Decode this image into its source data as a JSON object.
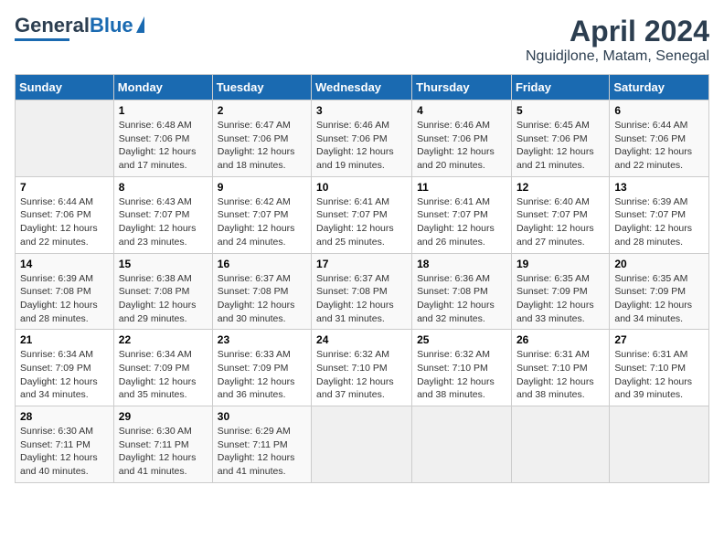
{
  "header": {
    "logo_line1": "General",
    "logo_line2": "Blue",
    "title": "April 2024",
    "subtitle": "Nguidjlone, Matam, Senegal"
  },
  "weekdays": [
    "Sunday",
    "Monday",
    "Tuesday",
    "Wednesday",
    "Thursday",
    "Friday",
    "Saturday"
  ],
  "weeks": [
    [
      {
        "day": "",
        "info": ""
      },
      {
        "day": "1",
        "info": "Sunrise: 6:48 AM\nSunset: 7:06 PM\nDaylight: 12 hours\nand 17 minutes."
      },
      {
        "day": "2",
        "info": "Sunrise: 6:47 AM\nSunset: 7:06 PM\nDaylight: 12 hours\nand 18 minutes."
      },
      {
        "day": "3",
        "info": "Sunrise: 6:46 AM\nSunset: 7:06 PM\nDaylight: 12 hours\nand 19 minutes."
      },
      {
        "day": "4",
        "info": "Sunrise: 6:46 AM\nSunset: 7:06 PM\nDaylight: 12 hours\nand 20 minutes."
      },
      {
        "day": "5",
        "info": "Sunrise: 6:45 AM\nSunset: 7:06 PM\nDaylight: 12 hours\nand 21 minutes."
      },
      {
        "day": "6",
        "info": "Sunrise: 6:44 AM\nSunset: 7:06 PM\nDaylight: 12 hours\nand 22 minutes."
      }
    ],
    [
      {
        "day": "7",
        "info": "Sunrise: 6:44 AM\nSunset: 7:06 PM\nDaylight: 12 hours\nand 22 minutes."
      },
      {
        "day": "8",
        "info": "Sunrise: 6:43 AM\nSunset: 7:07 PM\nDaylight: 12 hours\nand 23 minutes."
      },
      {
        "day": "9",
        "info": "Sunrise: 6:42 AM\nSunset: 7:07 PM\nDaylight: 12 hours\nand 24 minutes."
      },
      {
        "day": "10",
        "info": "Sunrise: 6:41 AM\nSunset: 7:07 PM\nDaylight: 12 hours\nand 25 minutes."
      },
      {
        "day": "11",
        "info": "Sunrise: 6:41 AM\nSunset: 7:07 PM\nDaylight: 12 hours\nand 26 minutes."
      },
      {
        "day": "12",
        "info": "Sunrise: 6:40 AM\nSunset: 7:07 PM\nDaylight: 12 hours\nand 27 minutes."
      },
      {
        "day": "13",
        "info": "Sunrise: 6:39 AM\nSunset: 7:07 PM\nDaylight: 12 hours\nand 28 minutes."
      }
    ],
    [
      {
        "day": "14",
        "info": "Sunrise: 6:39 AM\nSunset: 7:08 PM\nDaylight: 12 hours\nand 28 minutes."
      },
      {
        "day": "15",
        "info": "Sunrise: 6:38 AM\nSunset: 7:08 PM\nDaylight: 12 hours\nand 29 minutes."
      },
      {
        "day": "16",
        "info": "Sunrise: 6:37 AM\nSunset: 7:08 PM\nDaylight: 12 hours\nand 30 minutes."
      },
      {
        "day": "17",
        "info": "Sunrise: 6:37 AM\nSunset: 7:08 PM\nDaylight: 12 hours\nand 31 minutes."
      },
      {
        "day": "18",
        "info": "Sunrise: 6:36 AM\nSunset: 7:08 PM\nDaylight: 12 hours\nand 32 minutes."
      },
      {
        "day": "19",
        "info": "Sunrise: 6:35 AM\nSunset: 7:09 PM\nDaylight: 12 hours\nand 33 minutes."
      },
      {
        "day": "20",
        "info": "Sunrise: 6:35 AM\nSunset: 7:09 PM\nDaylight: 12 hours\nand 34 minutes."
      }
    ],
    [
      {
        "day": "21",
        "info": "Sunrise: 6:34 AM\nSunset: 7:09 PM\nDaylight: 12 hours\nand 34 minutes."
      },
      {
        "day": "22",
        "info": "Sunrise: 6:34 AM\nSunset: 7:09 PM\nDaylight: 12 hours\nand 35 minutes."
      },
      {
        "day": "23",
        "info": "Sunrise: 6:33 AM\nSunset: 7:09 PM\nDaylight: 12 hours\nand 36 minutes."
      },
      {
        "day": "24",
        "info": "Sunrise: 6:32 AM\nSunset: 7:10 PM\nDaylight: 12 hours\nand 37 minutes."
      },
      {
        "day": "25",
        "info": "Sunrise: 6:32 AM\nSunset: 7:10 PM\nDaylight: 12 hours\nand 38 minutes."
      },
      {
        "day": "26",
        "info": "Sunrise: 6:31 AM\nSunset: 7:10 PM\nDaylight: 12 hours\nand 38 minutes."
      },
      {
        "day": "27",
        "info": "Sunrise: 6:31 AM\nSunset: 7:10 PM\nDaylight: 12 hours\nand 39 minutes."
      }
    ],
    [
      {
        "day": "28",
        "info": "Sunrise: 6:30 AM\nSunset: 7:11 PM\nDaylight: 12 hours\nand 40 minutes."
      },
      {
        "day": "29",
        "info": "Sunrise: 6:30 AM\nSunset: 7:11 PM\nDaylight: 12 hours\nand 41 minutes."
      },
      {
        "day": "30",
        "info": "Sunrise: 6:29 AM\nSunset: 7:11 PM\nDaylight: 12 hours\nand 41 minutes."
      },
      {
        "day": "",
        "info": ""
      },
      {
        "day": "",
        "info": ""
      },
      {
        "day": "",
        "info": ""
      },
      {
        "day": "",
        "info": ""
      }
    ]
  ]
}
